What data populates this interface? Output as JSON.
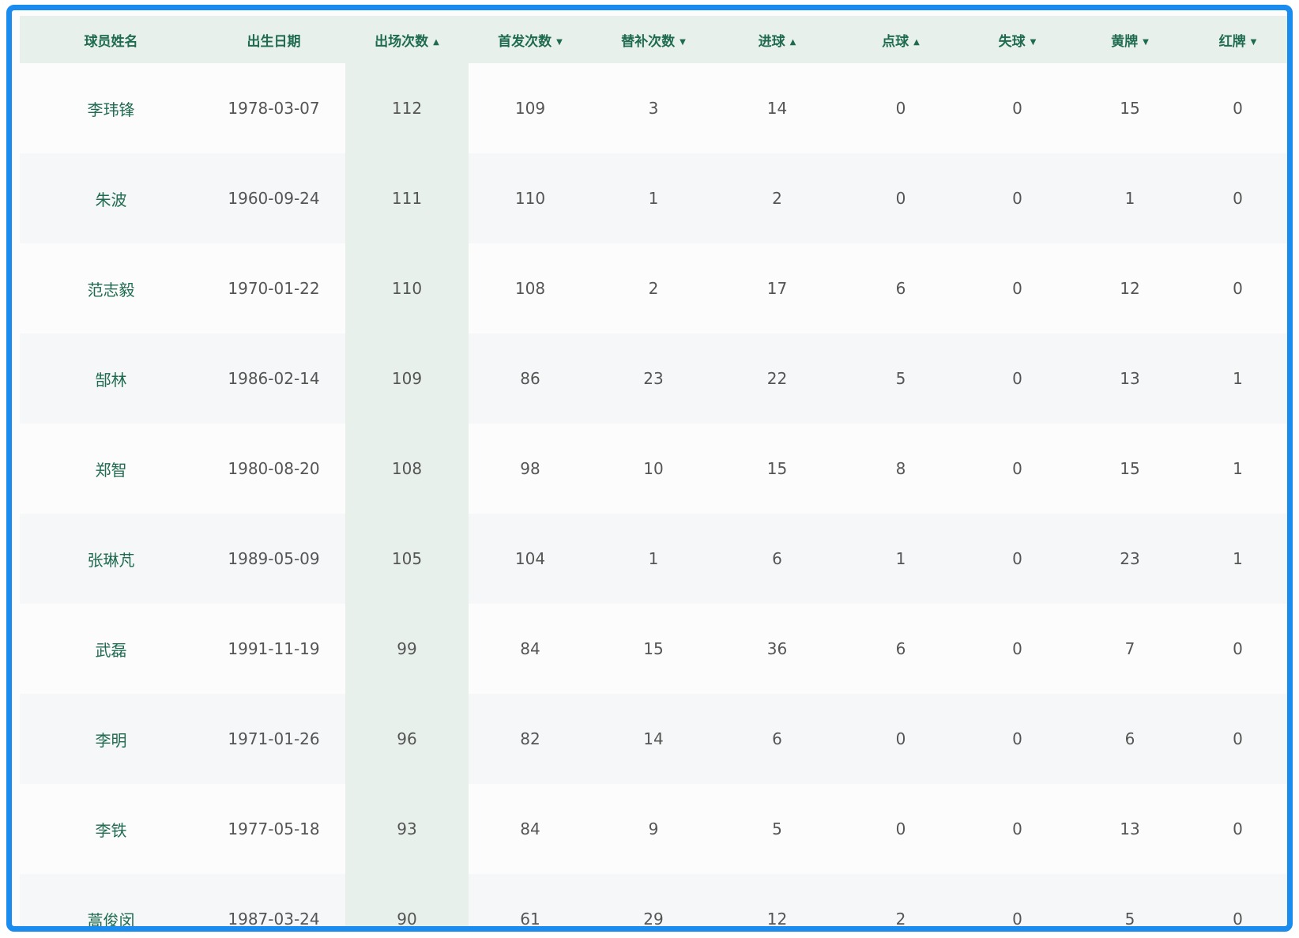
{
  "table": {
    "columns": [
      {
        "label": "球员姓名",
        "sort": ""
      },
      {
        "label": "出生日期",
        "sort": ""
      },
      {
        "label": "出场次数",
        "sort": "▲"
      },
      {
        "label": "首发次数",
        "sort": "▼"
      },
      {
        "label": "替补次数",
        "sort": "▼"
      },
      {
        "label": "进球",
        "sort": "▲"
      },
      {
        "label": "点球",
        "sort": "▲"
      },
      {
        "label": "失球",
        "sort": "▼"
      },
      {
        "label": "黄牌",
        "sort": "▼"
      },
      {
        "label": "红牌",
        "sort": "▼"
      }
    ],
    "rows": [
      [
        "李玮锋",
        "1978-03-07",
        "112",
        "109",
        "3",
        "14",
        "0",
        "0",
        "15",
        "0"
      ],
      [
        "朱波",
        "1960-09-24",
        "111",
        "110",
        "1",
        "2",
        "0",
        "0",
        "1",
        "0"
      ],
      [
        "范志毅",
        "1970-01-22",
        "110",
        "108",
        "2",
        "17",
        "6",
        "0",
        "12",
        "0"
      ],
      [
        "郜林",
        "1986-02-14",
        "109",
        "86",
        "23",
        "22",
        "5",
        "0",
        "13",
        "1"
      ],
      [
        "郑智",
        "1980-08-20",
        "108",
        "98",
        "10",
        "15",
        "8",
        "0",
        "15",
        "1"
      ],
      [
        "张琳芃",
        "1989-05-09",
        "105",
        "104",
        "1",
        "6",
        "1",
        "0",
        "23",
        "1"
      ],
      [
        "武磊",
        "1991-11-19",
        "99",
        "84",
        "15",
        "36",
        "6",
        "0",
        "7",
        "0"
      ],
      [
        "李明",
        "1971-01-26",
        "96",
        "82",
        "14",
        "6",
        "0",
        "0",
        "6",
        "0"
      ],
      [
        "李铁",
        "1977-05-18",
        "93",
        "84",
        "9",
        "5",
        "0",
        "0",
        "13",
        "0"
      ],
      [
        "蒿俊闵",
        "1987-03-24",
        "90",
        "61",
        "29",
        "12",
        "2",
        "0",
        "5",
        "0"
      ]
    ]
  },
  "colors": {
    "frame": "#1a8cf0",
    "header_bg": "#e8f0ec",
    "accent_text": "#1f6b4f"
  }
}
